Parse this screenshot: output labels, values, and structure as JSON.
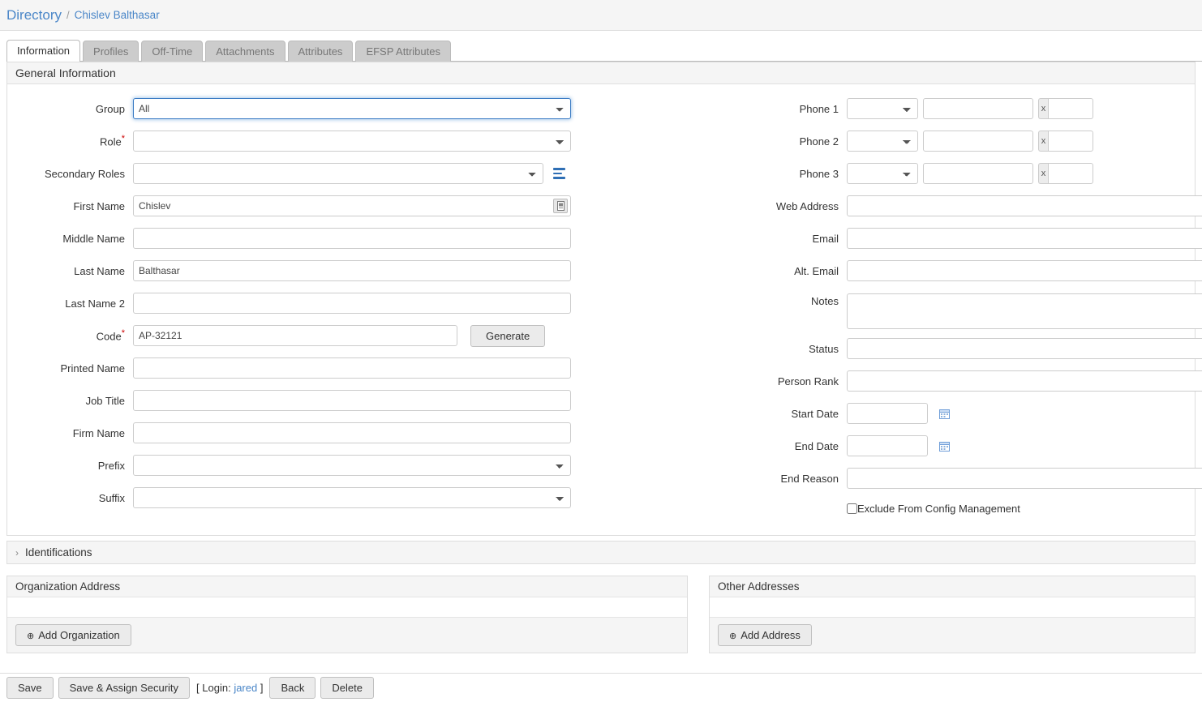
{
  "breadcrumb": {
    "root": "Directory",
    "separator": "/",
    "current": "Chislev Balthasar"
  },
  "tabs": [
    {
      "label": "Information",
      "active": true
    },
    {
      "label": "Profiles",
      "active": false
    },
    {
      "label": "Off-Time",
      "active": false
    },
    {
      "label": "Attachments",
      "active": false
    },
    {
      "label": "Attributes",
      "active": false
    },
    {
      "label": "EFSP Attributes",
      "active": false
    }
  ],
  "panel": {
    "title": "General Information"
  },
  "left_fields": {
    "group": {
      "label": "Group",
      "value": "All",
      "focused": true
    },
    "role": {
      "label": "Role",
      "required": "*",
      "value": ""
    },
    "secondary_roles": {
      "label": "Secondary Roles",
      "value": "",
      "icon": "list-dropdown-icon"
    },
    "first_name": {
      "label": "First Name",
      "value": "Chislev",
      "icon": "contact-card-icon"
    },
    "middle_name": {
      "label": "Middle Name",
      "value": ""
    },
    "last_name": {
      "label": "Last Name",
      "value": "Balthasar"
    },
    "last_name_2": {
      "label": "Last Name 2",
      "value": ""
    },
    "code": {
      "label": "Code",
      "required": "*",
      "value": "AP-32121",
      "button": "Generate"
    },
    "printed_name": {
      "label": "Printed Name",
      "value": ""
    },
    "job_title": {
      "label": "Job Title",
      "value": ""
    },
    "firm_name": {
      "label": "Firm Name",
      "value": ""
    },
    "prefix": {
      "label": "Prefix",
      "value": ""
    },
    "suffix": {
      "label": "Suffix",
      "value": ""
    }
  },
  "right_fields": {
    "phone1": {
      "label": "Phone 1",
      "type": "",
      "number": "",
      "ext_sep": "x",
      "ext": ""
    },
    "phone2": {
      "label": "Phone 2",
      "type": "",
      "number": "",
      "ext_sep": "x",
      "ext": ""
    },
    "phone3": {
      "label": "Phone 3",
      "type": "",
      "number": "",
      "ext_sep": "x",
      "ext": ""
    },
    "web_address": {
      "label": "Web Address",
      "value": ""
    },
    "email": {
      "label": "Email",
      "value": ""
    },
    "alt_email": {
      "label": "Alt. Email",
      "value": ""
    },
    "notes": {
      "label": "Notes",
      "value": ""
    },
    "status": {
      "label": "Status",
      "value": ""
    },
    "person_rank": {
      "label": "Person Rank",
      "value": ""
    },
    "start_date": {
      "label": "Start Date",
      "value": "",
      "icon": "calendar-icon"
    },
    "end_date": {
      "label": "End Date",
      "value": "",
      "icon": "calendar-icon"
    },
    "end_reason": {
      "label": "End Reason",
      "value": ""
    },
    "exclude_config": {
      "label": "Exclude From Config Management",
      "checked": false
    }
  },
  "identifications": {
    "label": "Identifications",
    "chevron": "›",
    "expanded": false
  },
  "organization_address": {
    "title": "Organization Address",
    "add_button": "Add Organization",
    "plus": "⊕"
  },
  "other_addresses": {
    "title": "Other Addresses",
    "add_button": "Add Address",
    "plus": "⊕"
  },
  "footer": {
    "save": "Save",
    "save_assign": "Save & Assign Security",
    "login_prefix": "[ Login: ",
    "login_user": "jared",
    "login_suffix": " ]",
    "back": "Back",
    "delete": "Delete"
  },
  "colors": {
    "link": "#4a86c8",
    "required": "#cc0000",
    "focus_border": "#3b7cc4",
    "tab_inactive": "#cccccc",
    "panel_head": "#f5f5f5",
    "icon_blue": "#2f6fb5"
  }
}
